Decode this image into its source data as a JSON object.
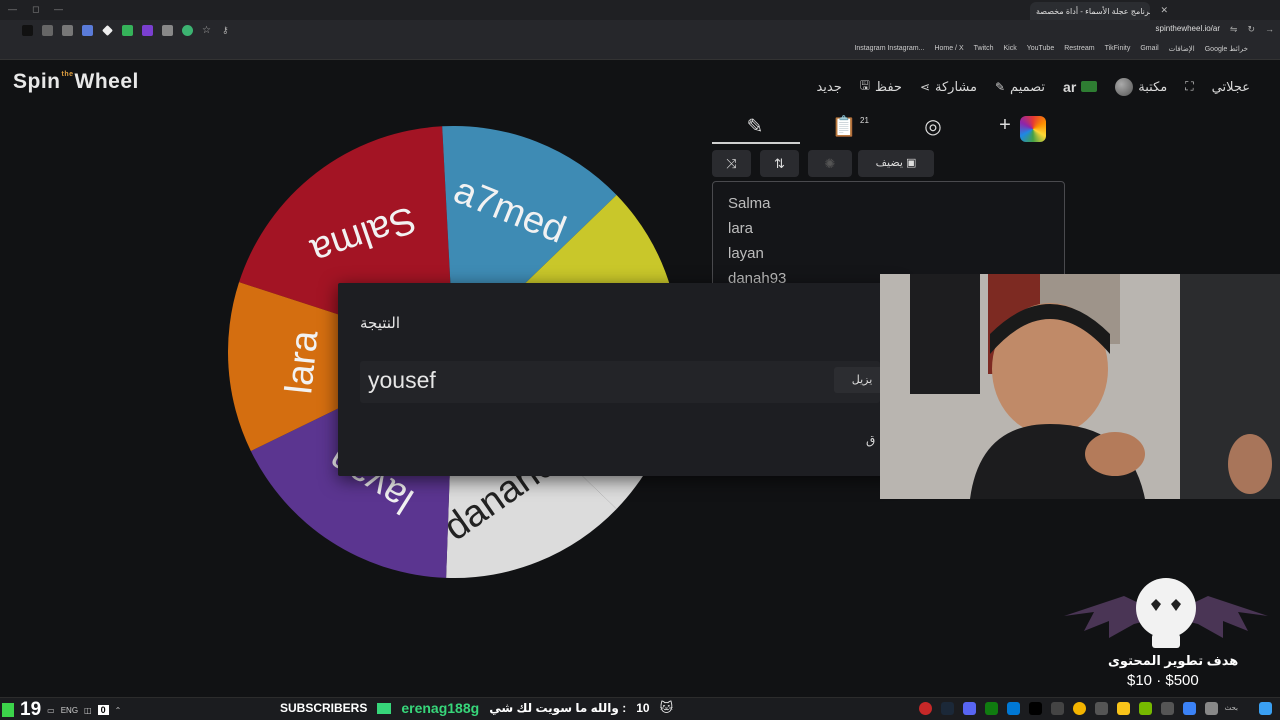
{
  "browser": {
    "tab_title": "برنامج عجلة الأسماء - أداة مخصصة",
    "url": "spinthewheel.io/ar",
    "bookmarks": [
      "Instagram Instagram...",
      "Home / X",
      "Twitch",
      "Kick",
      "YouTube",
      "Restream",
      "TikFinity",
      "Gmail",
      "الإضافات",
      "Google خرائط"
    ]
  },
  "header": {
    "logo_spin": "Spin",
    "logo_the": "the",
    "logo_wheel": "Wheel",
    "nav": {
      "new": "جديد",
      "save": "حفظ",
      "share": "مشاركة",
      "design": "تصميم",
      "lang": "ar",
      "library": "مكتبة",
      "fullscreen_icon": "fullscreen-icon",
      "spin_speed": "عجلاتي"
    }
  },
  "wheel": {
    "segments": [
      {
        "label": "Salma",
        "color": "#a31424"
      },
      {
        "label": "a7med",
        "color": "#3e8bb4"
      },
      {
        "label": "",
        "color": "#c9c72a"
      },
      {
        "label": "danah93",
        "color": "#dcdcdc"
      },
      {
        "label": "layan",
        "color": "#5b3590"
      },
      {
        "label": "lara",
        "color": "#d46e10"
      }
    ]
  },
  "panel": {
    "entries_count": "21",
    "add_image_label": "يضيف",
    "names": [
      "Salma",
      "lara",
      "layan",
      "danah93"
    ]
  },
  "modal": {
    "title": "النتيجة",
    "result": "yousef",
    "remove_label": "يزيل",
    "close_label": "ق"
  },
  "stream": {
    "goal_title": "هدف تطوير المحتوى",
    "goal_amount": "$10 · $500",
    "subscribers_label": "SUBSCRIBERS",
    "follower": "erenag188g",
    "message": "والله ما سويت لك شي :",
    "message_count": "10",
    "viewer_count": "19",
    "lang_indicator": "ENG",
    "zero_count": "0"
  }
}
